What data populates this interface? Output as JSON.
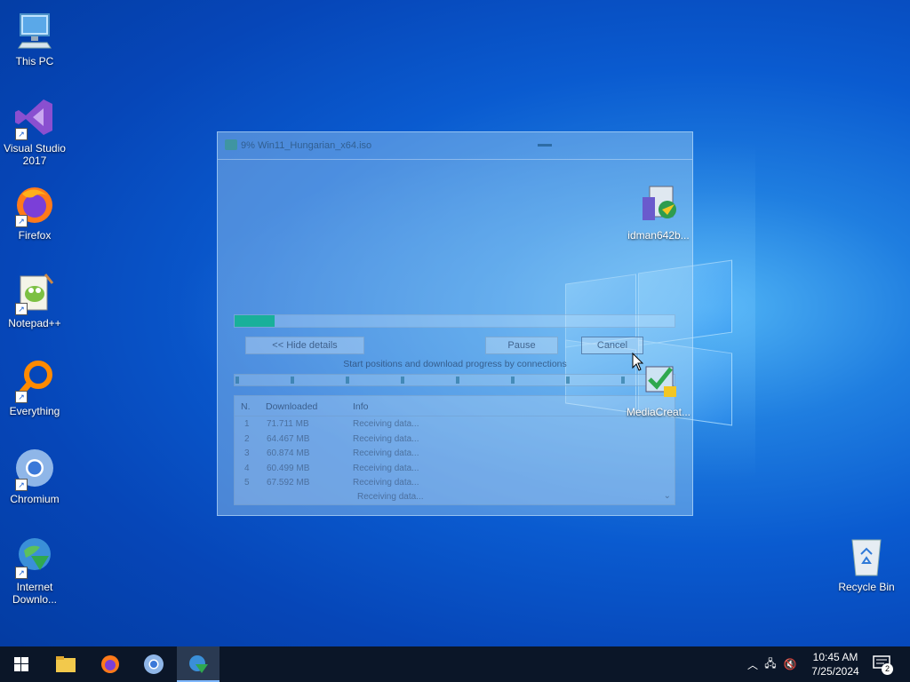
{
  "desktop": {
    "icons": [
      {
        "label": "This PC"
      },
      {
        "label": "Visual Studio 2017"
      },
      {
        "label": "Firefox"
      },
      {
        "label": "Notepad++"
      },
      {
        "label": "Everything"
      },
      {
        "label": "Chromium"
      },
      {
        "label": "Internet Downlo..."
      },
      {
        "label": "idman642b..."
      },
      {
        "label": "MediaCreat..."
      },
      {
        "label": "Recycle Bin"
      }
    ]
  },
  "dialog": {
    "title": "9% Win11_Hungarian_x64.iso",
    "progress_percent": 9,
    "buttons": {
      "hide_details": "<< Hide details",
      "pause": "Pause",
      "cancel": "Cancel"
    },
    "connections_label": "Start positions and download progress by connections",
    "table": {
      "headers": [
        "N.",
        "Downloaded",
        "Info"
      ],
      "rows": [
        {
          "n": "1",
          "downloaded": "71.711 MB",
          "info": "Receiving data..."
        },
        {
          "n": "2",
          "downloaded": "64.467 MB",
          "info": "Receiving data..."
        },
        {
          "n": "3",
          "downloaded": "60.874 MB",
          "info": "Receiving data..."
        },
        {
          "n": "4",
          "downloaded": "60.499 MB",
          "info": "Receiving data..."
        },
        {
          "n": "5",
          "downloaded": "67.592 MB",
          "info": "Receiving data..."
        },
        {
          "n": "",
          "downloaded": "",
          "info": "Receiving data..."
        }
      ]
    }
  },
  "taskbar": {
    "clock_time": "10:45 AM",
    "clock_date": "7/25/2024",
    "notification_count": "2"
  },
  "colors": {
    "progress": "#19b09a",
    "taskbar": "#0b1628"
  }
}
